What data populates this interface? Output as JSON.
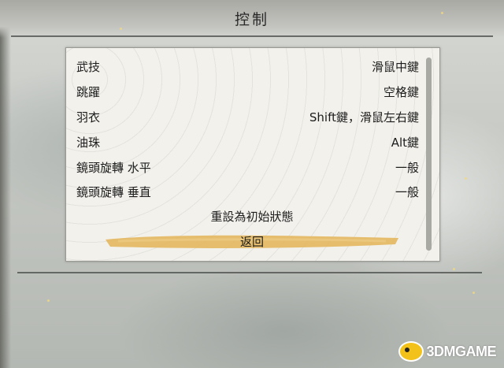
{
  "header": {
    "title": "控制"
  },
  "settings": {
    "rows": [
      {
        "label": "武技",
        "value": "滑鼠中鍵"
      },
      {
        "label": "跳躍",
        "value": "空格鍵"
      },
      {
        "label": "羽衣",
        "value": "Shift鍵，滑鼠左右鍵"
      },
      {
        "label": "油珠",
        "value": "Alt鍵"
      },
      {
        "label": "鏡頭旋轉 水平",
        "value": "一般"
      },
      {
        "label": "鏡頭旋轉 垂直",
        "value": "一般"
      }
    ],
    "reset_label": "重設為初始狀態",
    "back_label": "返回"
  },
  "watermark": {
    "text": "3DMGAME"
  },
  "colors": {
    "panel": "#f2f1ec",
    "highlight_brush": "#e3b457",
    "text": "#1c1c1c"
  }
}
